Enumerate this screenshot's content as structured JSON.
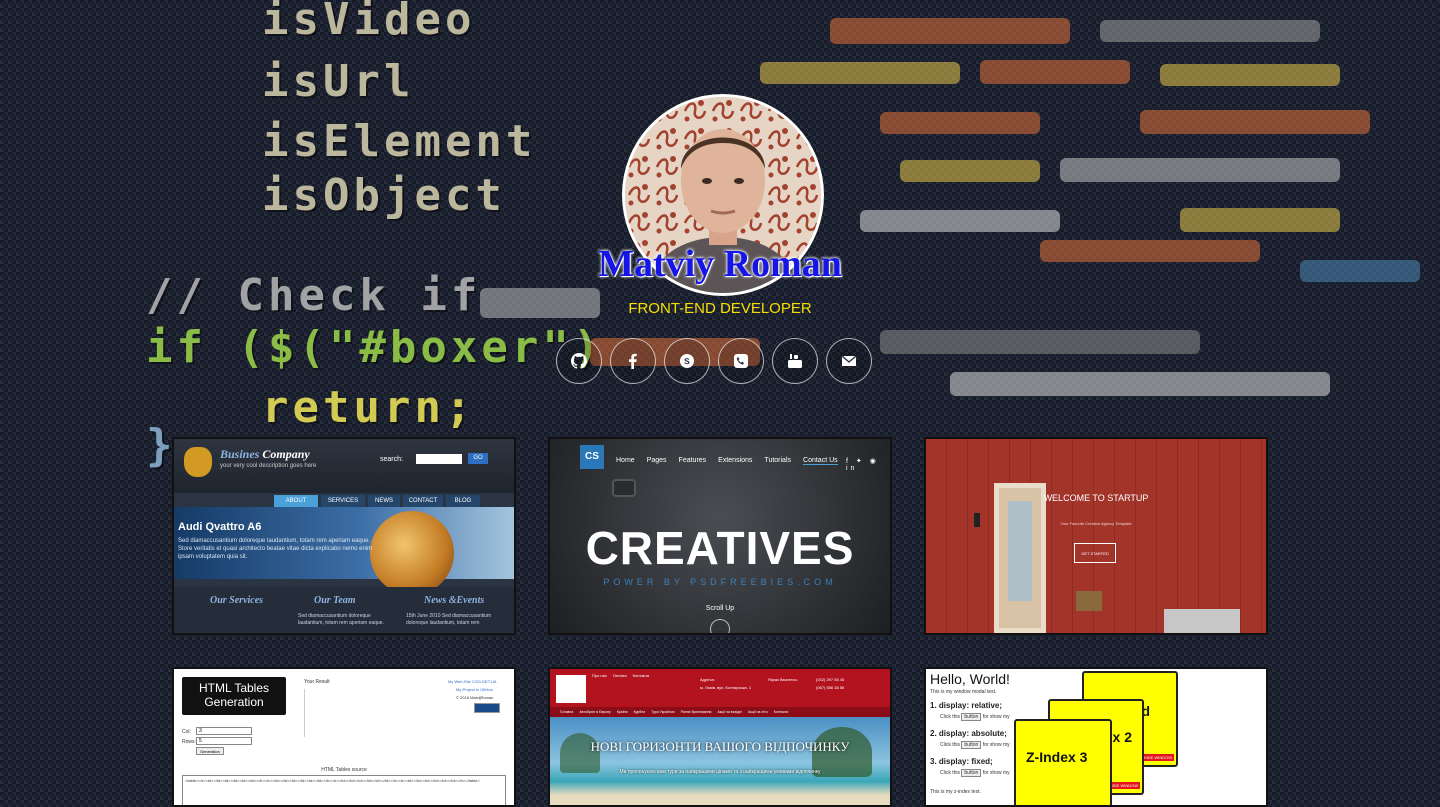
{
  "profile": {
    "name": "Matviy Roman",
    "role": "FRONT-END DEVELOPER"
  },
  "background_code": {
    "lines": [
      "isVideo",
      "isUrl",
      "isElement",
      "isObject",
      "// Check if",
      "if ($(\"#boxer\")",
      "return;",
      "}"
    ]
  },
  "socials": [
    {
      "icon": "github-icon"
    },
    {
      "icon": "facebook-icon"
    },
    {
      "icon": "skype-icon"
    },
    {
      "icon": "phone-icon"
    },
    {
      "icon": "youtube-icon"
    },
    {
      "icon": "email-icon"
    }
  ],
  "projects": {
    "business": {
      "brand": "Busines",
      "brand2": "Company",
      "tagline": "your very cool description goes here",
      "search_label": "search:",
      "go": "GO",
      "nav": [
        "ABOUT",
        "SERVICES",
        "NEWS",
        "CONTACT",
        "BLOG"
      ],
      "banner_title": "Audi Qvattro A6",
      "banner_text": "Sed diamaccusantium doloreque laudantium, totam rem aperiam eaque. Store veritatis et quasi architecto beatae vitae dicta explicabo nemo enim ipsam voluptatem quia sit.",
      "col1": "Our Services",
      "col2": "Our Team",
      "col3": "News &Events",
      "col2_text": "Sed diamaccusantium doloreque laudantium, totam rem aperiam eaque.",
      "col3_text": "15th June 2010 Sed diamaccusantium doloreque laudantium, totam rem"
    },
    "creatives": {
      "logo": "CS",
      "nav": [
        "Home",
        "Pages",
        "Features",
        "Extensions",
        "Tutorials",
        "Contact Us"
      ],
      "title": "CREATIVES",
      "subtitle": "POWER BY PSDFREEBIES.COM",
      "scroll": "Scroll Up"
    },
    "startup": {
      "title": "WELCOME TO STARTUP",
      "subtitle": "Your Favorite Creative Agency Template",
      "button": "GET STARTED"
    },
    "html_tables": {
      "title": "HTML Tables Generation",
      "result_label": "Your Result",
      "col_label": "Col:",
      "rows_label": "Rows:",
      "col_value": "3",
      "rows_value": "5",
      "button": "Generation",
      "source_label": "HTML Tables source",
      "links": [
        "My Web-Site CGG.DET.UA",
        "My Project in GitHub",
        "© 2016 MatvijRoman"
      ],
      "code": "<table><tr><td></td><td></td><td></td></tr><tr><td></td><td></td><td></td></tr><tr><td></td><td></td><td></td></tr><tr><td></td><td></td><td></td></tr></table>"
    },
    "travel": {
      "nav": [
        "Головна",
        "Автобусні в Європу",
        "Країни",
        "Курбни",
        "Тури Україною",
        "Раннє бронювання",
        "Акції на вихідні",
        "Акції на літо",
        "Контакти"
      ],
      "top_links": [
        "Про нас",
        "Оплата",
        "Контакти"
      ],
      "address_label": "Адреса:",
      "address": "м. Львів, вул. Котлярська, 1",
      "hours_label": "Якраз бачитесь:",
      "phone1": "(032) 297 56 45",
      "phone2": "(067) 556 38 56",
      "heading": "НОВІ ГОРИЗОНТИ ВАШОГО ВІДПОЧИНКУ",
      "text": "Ми пропонуємо вам тури за найкращими цінами та з найкращими умовами відпочинку"
    },
    "zindex": {
      "heading": "Hello, World!",
      "intro": "This is my window modal test.",
      "items": [
        "display: relative;",
        "display: absolute;",
        "display: fixed;"
      ],
      "click_text": "Click this",
      "button": "button",
      "after_text": "for show my",
      "footer": "This is my z-index test.",
      "box1": "d",
      "box2": "x 2",
      "box3": "Z-Index 3",
      "red_label": "HIDE WINDOW"
    }
  }
}
